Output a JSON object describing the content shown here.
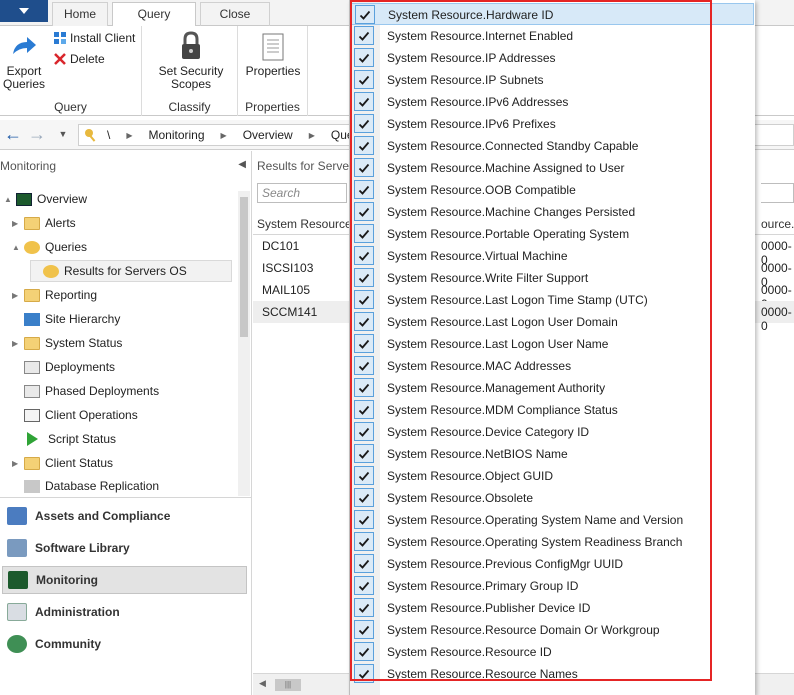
{
  "ribbon": {
    "tabs": [
      "Home",
      "Query",
      "Close"
    ],
    "groups": {
      "query": {
        "label": "Query",
        "export_label_1": "Export",
        "export_label_2": "Queries",
        "install_client": "Install Client",
        "delete": "Delete"
      },
      "classify": {
        "label": "Classify",
        "security_label_1": "Set Security",
        "security_label_2": "Scopes"
      },
      "properties": {
        "label": "Properties",
        "button_label": "Properties"
      }
    }
  },
  "address_bar": {
    "root": "\\",
    "crumbs": [
      "Monitoring",
      "Overview",
      "Queri"
    ]
  },
  "nav": {
    "header": "Monitoring",
    "items": [
      {
        "label": "Overview",
        "level": 0,
        "expander": "▲"
      },
      {
        "label": "Alerts",
        "level": 1,
        "expander": "▶"
      },
      {
        "label": "Queries",
        "level": 1,
        "expander": "▲"
      },
      {
        "label": "Results for Servers OS",
        "level": 2,
        "expander": ""
      },
      {
        "label": "Reporting",
        "level": 1,
        "expander": "▶"
      },
      {
        "label": "Site Hierarchy",
        "level": 1,
        "expander": ""
      },
      {
        "label": "System Status",
        "level": 1,
        "expander": "▶"
      },
      {
        "label": "Deployments",
        "level": 1,
        "expander": ""
      },
      {
        "label": "Phased Deployments",
        "level": 1,
        "expander": ""
      },
      {
        "label": "Client Operations",
        "level": 1,
        "expander": ""
      },
      {
        "label": "Script Status",
        "level": 1,
        "expander": ""
      },
      {
        "label": "Client Status",
        "level": 1,
        "expander": "▶"
      },
      {
        "label": "Database Replication",
        "level": 1,
        "expander": ""
      }
    ]
  },
  "workspaces": [
    "Assets and Compliance",
    "Software Library",
    "Monitoring",
    "Administration",
    "Community"
  ],
  "results": {
    "title": "Results for Server",
    "search_placeholder": "Search",
    "columns": [
      "System Resource.",
      "ource.A"
    ],
    "rows": [
      {
        "name": "DC101",
        "col2": "0000-0"
      },
      {
        "name": "ISCSI103",
        "col2": "0000-0"
      },
      {
        "name": "MAIL105",
        "col2": "0000-0"
      },
      {
        "name": "SCCM141",
        "col2": "0000-0"
      }
    ]
  },
  "column_menu": {
    "items": [
      "System Resource.Hardware ID",
      "System Resource.Internet Enabled",
      "System Resource.IP Addresses",
      "System Resource.IP Subnets",
      "System Resource.IPv6 Addresses",
      "System Resource.IPv6 Prefixes",
      "System Resource.Connected Standby Capable",
      "System Resource.Machine Assigned to User",
      "System Resource.OOB Compatible",
      "System Resource.Machine Changes Persisted",
      "System Resource.Portable Operating System",
      "System Resource.Virtual Machine",
      "System Resource.Write Filter Support",
      "System Resource.Last Logon Time Stamp (UTC)",
      "System Resource.Last Logon User Domain",
      "System Resource.Last Logon User Name",
      "System Resource.MAC Addresses",
      "System Resource.Management Authority",
      "System Resource.MDM Compliance Status",
      "System Resource.Device Category ID",
      "System Resource.NetBIOS Name",
      "System Resource.Object GUID",
      "System Resource.Obsolete",
      "System Resource.Operating System Name and Version",
      "System Resource.Operating System Readiness Branch",
      "System Resource.Previous ConfigMgr UUID",
      "System Resource.Primary Group ID",
      "System Resource.Publisher Device ID",
      "System Resource.Resource Domain Or Workgroup",
      "System Resource.Resource ID",
      "System Resource.Resource Names"
    ],
    "highlight_color": "#e52525"
  }
}
